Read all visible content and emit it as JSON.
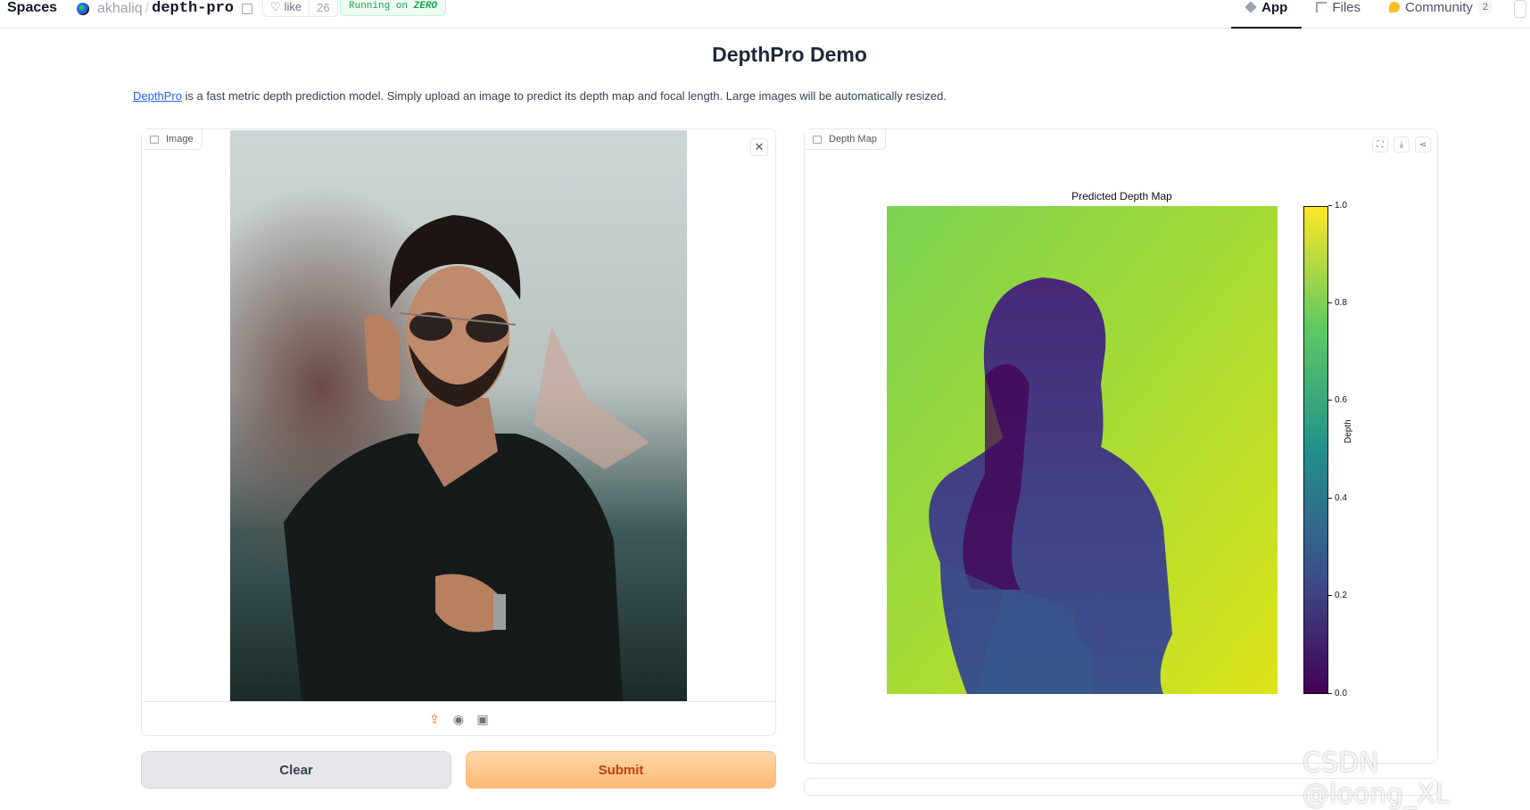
{
  "topbar": {
    "spaces_label": "Spaces",
    "owner": "akhaliq",
    "separator": "/",
    "repo_name": "depth-pro",
    "like_label": "like",
    "like_count": "26",
    "status_prefix": "Running on",
    "status_hardware": "ZERO",
    "tabs": [
      {
        "label": "App",
        "icon": "app-icon",
        "active": true
      },
      {
        "label": "Files",
        "icon": "files-icon",
        "active": false
      },
      {
        "label": "Community",
        "icon": "community-icon",
        "active": false,
        "count": "2"
      }
    ]
  },
  "main": {
    "title": "DepthPro Demo",
    "description_link": "DepthPro",
    "description_rest": " is a fast metric depth prediction model. Simply upload an image to predict its depth map and focal length. Large images will be automatically resized."
  },
  "input_panel": {
    "label": "Image",
    "close_symbol": "✕",
    "toolbar_icons": [
      "upload-icon",
      "webcam-icon",
      "clipboard-icon"
    ]
  },
  "output_panel": {
    "label": "Depth Map",
    "action_icons": [
      "fullscreen-icon",
      "download-icon",
      "share-icon"
    ],
    "plot_title": "Predicted Depth Map",
    "colorbar_label": "Depth",
    "colorbar_ticks": [
      "1.0",
      "0.8",
      "0.6",
      "0.4",
      "0.2",
      "0.0"
    ],
    "colormap": "viridis"
  },
  "buttons": {
    "clear": "Clear",
    "submit": "Submit"
  },
  "watermark": "CSDN @loong_XL",
  "colors": {
    "accent": "#f97316",
    "submit_bg": "#fdba74",
    "link": "#2563eb",
    "status_green": "#16a34a"
  }
}
